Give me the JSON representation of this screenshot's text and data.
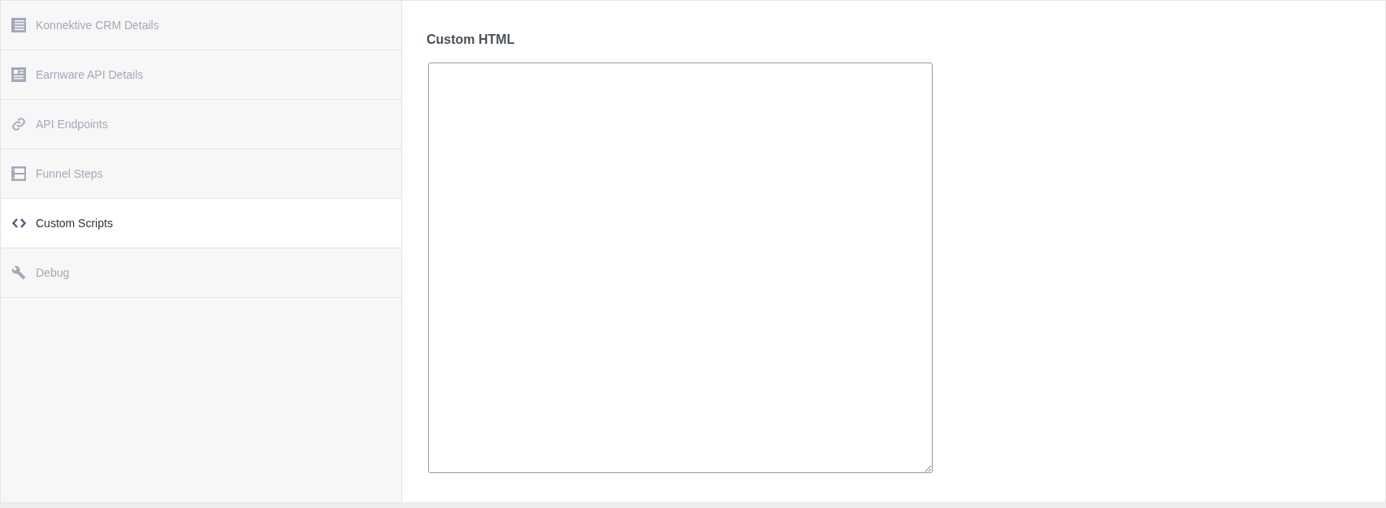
{
  "sidebar": {
    "items": [
      {
        "label": "Konnektive CRM Details",
        "selected": false
      },
      {
        "label": "Earnware API Details",
        "selected": false
      },
      {
        "label": "API Endpoints",
        "selected": false
      },
      {
        "label": "Funnel Steps",
        "selected": false
      },
      {
        "label": "Custom Scripts",
        "selected": true
      },
      {
        "label": "Debug",
        "selected": false
      }
    ]
  },
  "main": {
    "title": "Custom HTML"
  }
}
